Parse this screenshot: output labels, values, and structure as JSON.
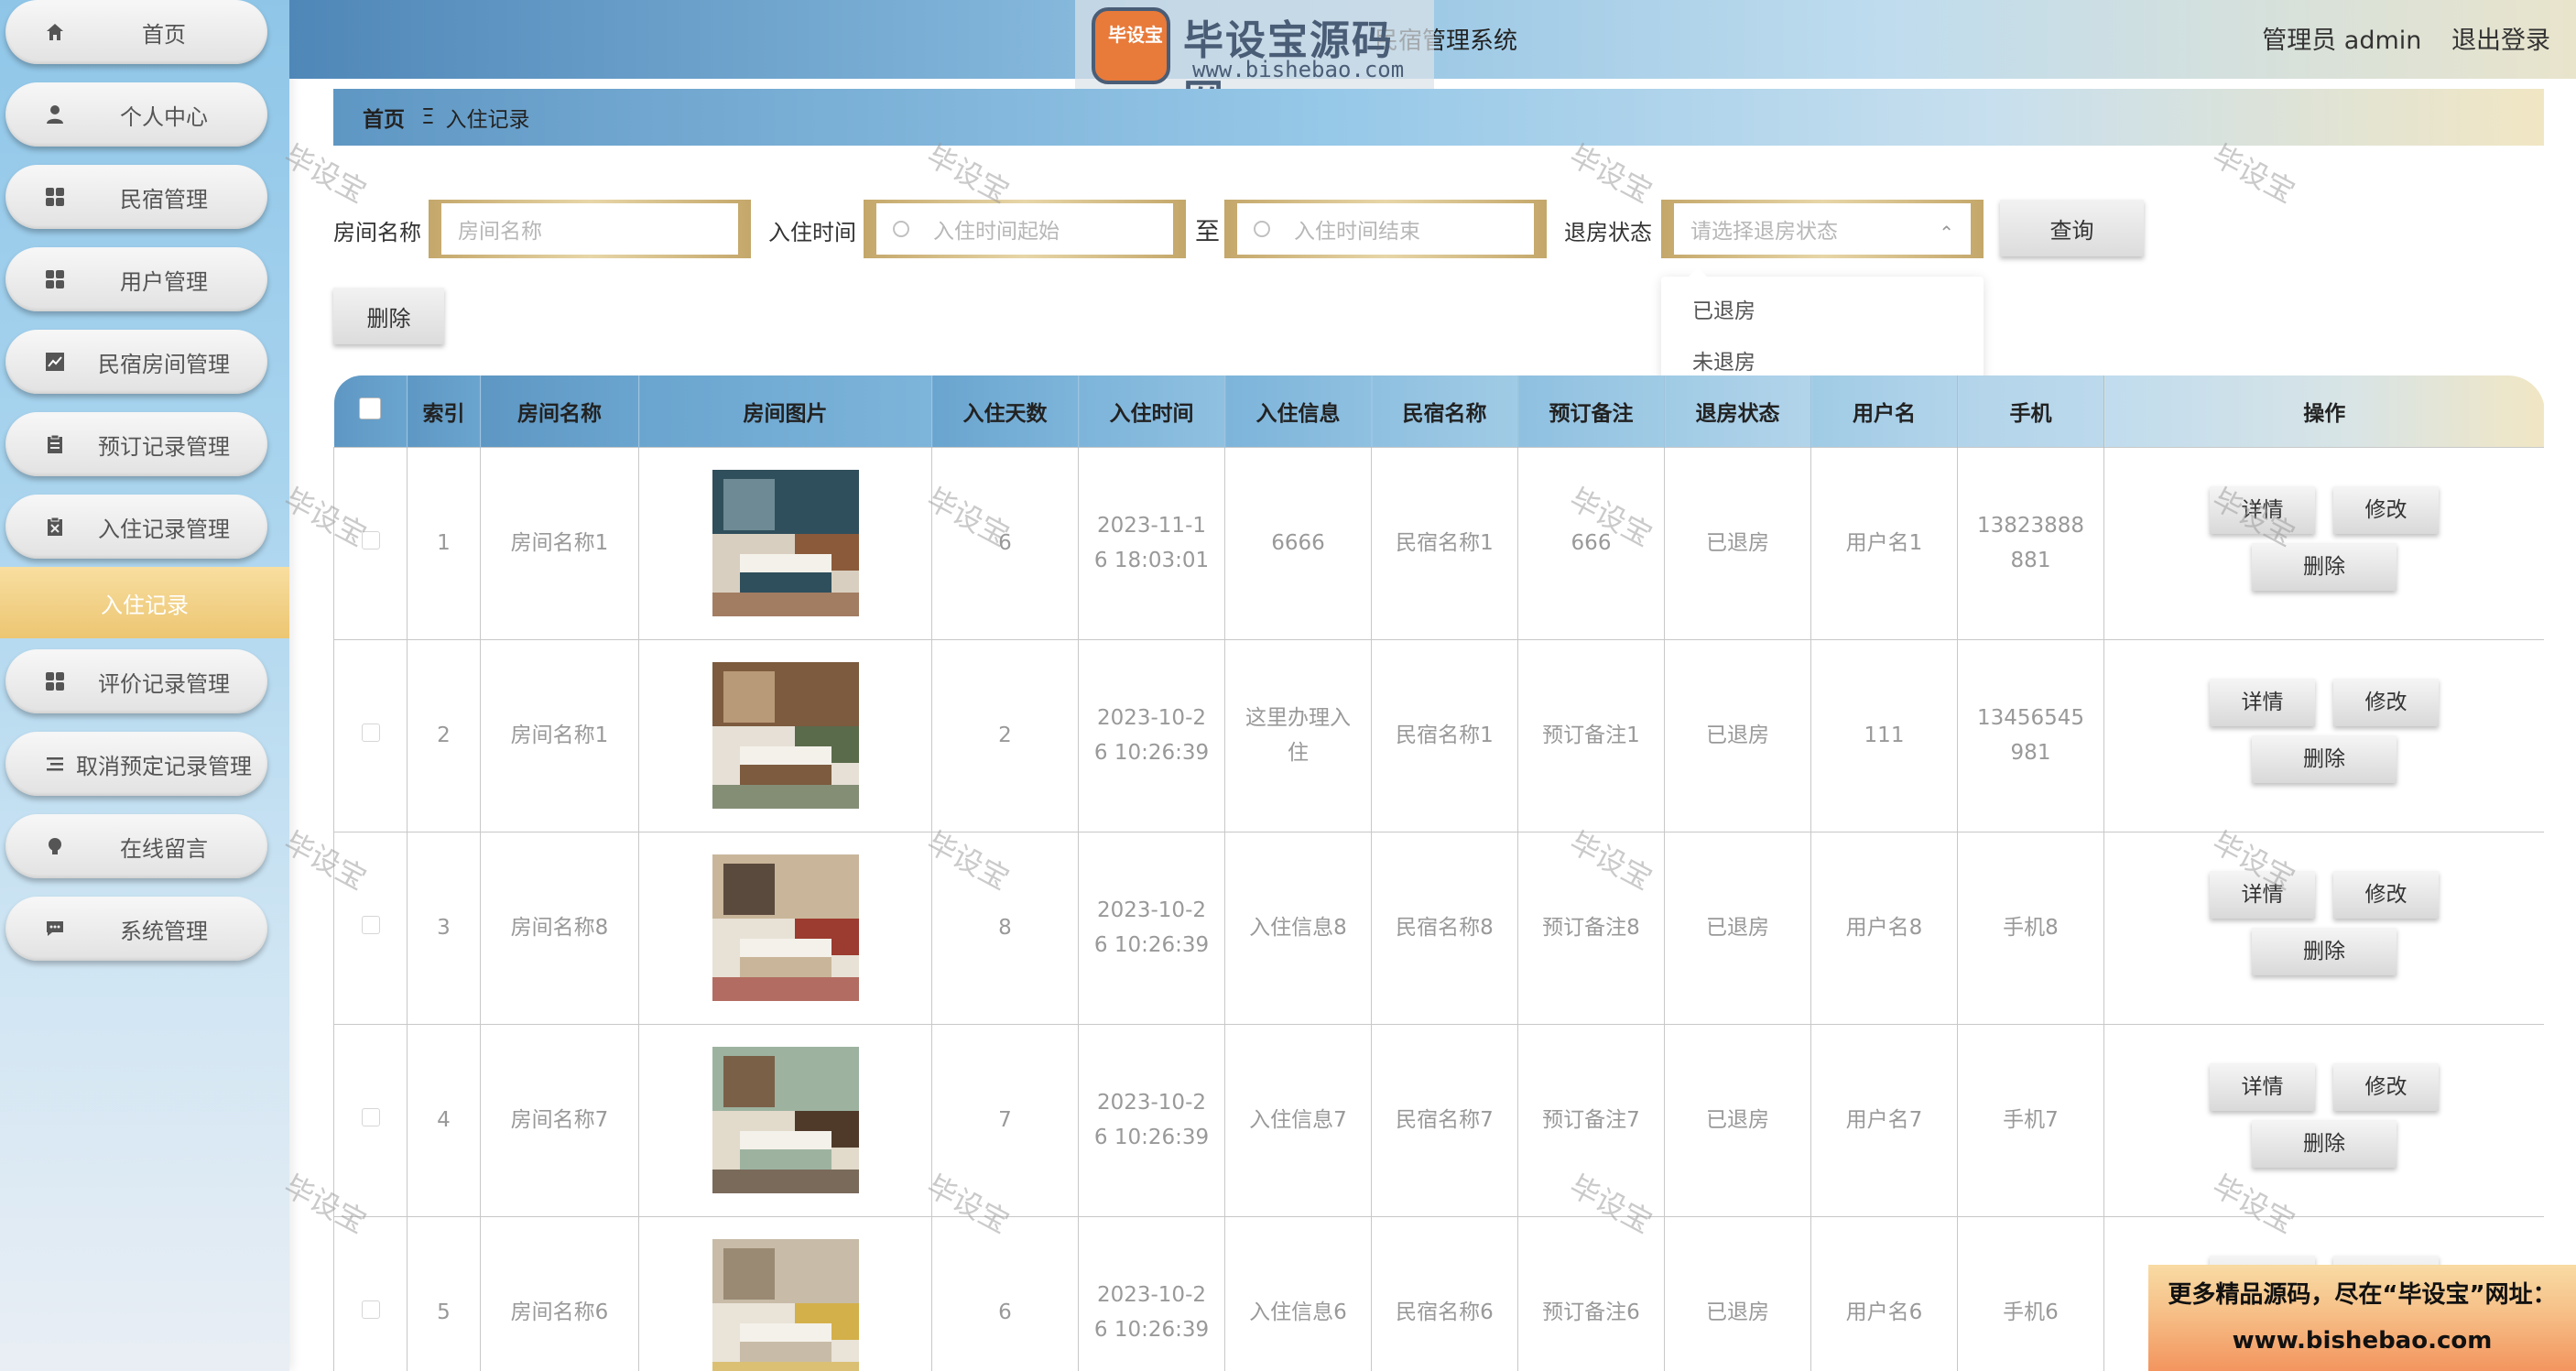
{
  "topbar": {
    "title": "民宿管理系统",
    "user": "管理员 admin",
    "logout": "退出登录"
  },
  "logo": {
    "mark": "毕设宝",
    "name": "毕设宝源码网",
    "url": "www.bishebao.com"
  },
  "sidebar": {
    "items": [
      {
        "label": "首页",
        "icon": "home-icon"
      },
      {
        "label": "个人中心",
        "icon": "user-icon"
      },
      {
        "label": "民宿管理",
        "icon": "grid-icon"
      },
      {
        "label": "用户管理",
        "icon": "grid-icon"
      },
      {
        "label": "民宿房间管理",
        "icon": "chart-icon"
      },
      {
        "label": "预订记录管理",
        "icon": "clipboard-icon"
      },
      {
        "label": "入住记录管理",
        "icon": "clipboard-x-icon"
      },
      {
        "label": "评价记录管理",
        "icon": "grid-icon"
      },
      {
        "label": "取消预定记录管理",
        "icon": "list-icon"
      },
      {
        "label": "在线留言",
        "icon": "bulb-icon"
      },
      {
        "label": "系统管理",
        "icon": "chat-icon"
      }
    ],
    "active_sub": "入住记录"
  },
  "breadcrumb": {
    "home": "首页",
    "sep": "Ξ",
    "current": "入住记录"
  },
  "search": {
    "room_label": "房间名称",
    "room_placeholder": "房间名称",
    "time_label": "入住时间",
    "time_start_placeholder": "入住时间起始",
    "to": "至",
    "time_end_placeholder": "入住时间结束",
    "status_label": "退房状态",
    "status_placeholder": "请选择退房状态",
    "query": "查询"
  },
  "dropdown": {
    "options": [
      "已退房",
      "未退房"
    ]
  },
  "toolbar": {
    "delete": "删除"
  },
  "table": {
    "headers": [
      "索引",
      "房间名称",
      "房间图片",
      "入住天数",
      "入住时间",
      "入住信息",
      "民宿名称",
      "预订备注",
      "退房状态",
      "用户名",
      "手机",
      "操作"
    ],
    "actions": {
      "detail": "详情",
      "edit": "修改",
      "delete": "删除"
    },
    "rows": [
      {
        "index": "1",
        "room": "房间名称1",
        "days": "6",
        "time": "2023-11-16 18:03:01",
        "info": "6666",
        "homestay": "民宿名称1",
        "remark": "666",
        "status": "已退房",
        "user": "用户名1",
        "phone": "13823888881"
      },
      {
        "index": "2",
        "room": "房间名称1",
        "days": "2",
        "time": "2023-10-26 10:26:39",
        "info": "这里办理入住",
        "homestay": "民宿名称1",
        "remark": "预订备注1",
        "status": "已退房",
        "user": "111",
        "phone": "13456545981"
      },
      {
        "index": "3",
        "room": "房间名称8",
        "days": "8",
        "time": "2023-10-26 10:26:39",
        "info": "入住信息8",
        "homestay": "民宿名称8",
        "remark": "预订备注8",
        "status": "已退房",
        "user": "用户名8",
        "phone": "手机8"
      },
      {
        "index": "4",
        "room": "房间名称7",
        "days": "7",
        "time": "2023-10-26 10:26:39",
        "info": "入住信息7",
        "homestay": "民宿名称7",
        "remark": "预订备注7",
        "status": "已退房",
        "user": "用户名7",
        "phone": "手机7"
      },
      {
        "index": "5",
        "room": "房间名称6",
        "days": "6",
        "time": "2023-10-26 10:26:39",
        "info": "入住信息6",
        "homestay": "民宿名称6",
        "remark": "预订备注6",
        "status": "已退房",
        "user": "用户名6",
        "phone": "手机6"
      }
    ]
  },
  "watermark": "毕设宝",
  "promo": {
    "line1": "更多精品源码，尽在“毕设宝”网址：",
    "line2": "www.bishebao.com"
  }
}
